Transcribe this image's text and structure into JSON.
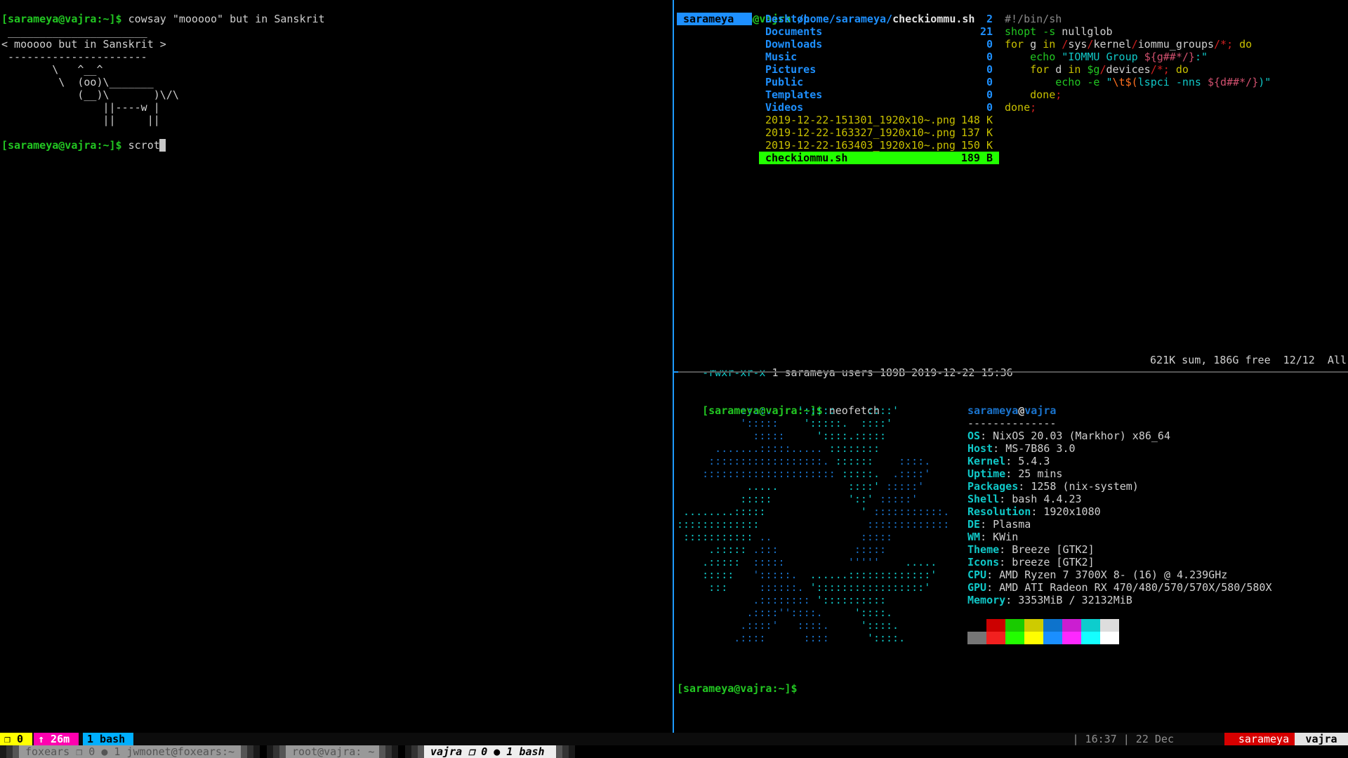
{
  "colors": {
    "fg": "#d0d0d0",
    "green": "#22c722",
    "yellow": "#c8c000",
    "red": "#d02020",
    "cyan": "#10c8c8",
    "blue": "#1a73cc",
    "lightblue": "#1e90ff",
    "pink": "#d0506e",
    "orange": "#ff7020",
    "comment": "#8a8a8a",
    "gray": "#a0a0a0"
  },
  "left": {
    "lines": [
      [
        {
          "t": "[sarameya@vajra:~]$ ",
          "c": "green",
          "b": 1
        },
        {
          "t": "cowsay \"mooooo\" but in Sanskrit",
          "c": "fg"
        }
      ],
      [
        {
          "t": " ______________________",
          "c": "fg"
        }
      ],
      [
        {
          "t": "< mooooo but in Sanskrit >",
          "c": "fg"
        }
      ],
      [
        {
          "t": " ----------------------",
          "c": "fg"
        }
      ],
      [
        {
          "t": "        \\   ^__^",
          "c": "fg"
        }
      ],
      [
        {
          "t": "         \\  (oo)\\_______",
          "c": "fg"
        }
      ],
      [
        {
          "t": "            (__)\\       )\\/\\",
          "c": "fg"
        }
      ],
      [
        {
          "t": "                ||----w |",
          "c": "fg"
        }
      ],
      [
        {
          "t": "                ||     ||",
          "c": "fg"
        }
      ],
      [],
      [
        {
          "t": "[sarameya@vajra:~]$ ",
          "c": "green",
          "b": 1
        },
        {
          "t": "scrot",
          "c": "fg"
        }
      ]
    ]
  },
  "ranger": {
    "title": {
      "user_host": "sarameya@vajra",
      "path": "/home/sarameya/",
      "file": "checkiommu.sh"
    },
    "parent_selected": "sarameya",
    "entries": [
      {
        "name": "Desktop",
        "size": "2",
        "type": "dir"
      },
      {
        "name": "Documents",
        "size": "21",
        "type": "dir"
      },
      {
        "name": "Downloads",
        "size": "0",
        "type": "dir"
      },
      {
        "name": "Music",
        "size": "0",
        "type": "dir"
      },
      {
        "name": "Pictures",
        "size": "0",
        "type": "dir"
      },
      {
        "name": "Public",
        "size": "0",
        "type": "dir"
      },
      {
        "name": "Templates",
        "size": "0",
        "type": "dir"
      },
      {
        "name": "Videos",
        "size": "0",
        "type": "dir"
      },
      {
        "name": "2019-12-22-151301_1920x10~.png",
        "size": "148 K",
        "type": "file"
      },
      {
        "name": "2019-12-22-163327_1920x10~.png",
        "size": "137 K",
        "type": "file"
      },
      {
        "name": "2019-12-22-163403_1920x10~.png",
        "size": "150 K",
        "type": "file"
      },
      {
        "name": "checkiommu.sh",
        "size": "189 B",
        "type": "sel"
      }
    ],
    "preview": [
      [
        {
          "t": "#!/bin/sh",
          "c": "comment"
        }
      ],
      [
        {
          "t": "shopt",
          "c": "green"
        },
        {
          "t": " ",
          "c": "fg"
        },
        {
          "t": "-s",
          "c": "green"
        },
        {
          "t": " nullglob",
          "c": "fg"
        }
      ],
      [
        {
          "t": "for",
          "c": "yellow"
        },
        {
          "t": " g ",
          "c": "fg"
        },
        {
          "t": "in",
          "c": "yellow"
        },
        {
          "t": " ",
          "c": "fg"
        },
        {
          "t": "/",
          "c": "red"
        },
        {
          "t": "sys",
          "c": "fg"
        },
        {
          "t": "/",
          "c": "red"
        },
        {
          "t": "kernel",
          "c": "fg"
        },
        {
          "t": "/",
          "c": "red"
        },
        {
          "t": "iommu_groups",
          "c": "fg"
        },
        {
          "t": "/*;",
          "c": "red"
        },
        {
          "t": " ",
          "c": "fg"
        },
        {
          "t": "do",
          "c": "yellow"
        }
      ],
      [
        {
          "t": "    ",
          "c": "fg"
        },
        {
          "t": "echo",
          "c": "green"
        },
        {
          "t": " ",
          "c": "fg"
        },
        {
          "t": "\"IOMMU Group ",
          "c": "cyan"
        },
        {
          "t": "${g##*/}",
          "c": "pink"
        },
        {
          "t": ":\"",
          "c": "cyan"
        }
      ],
      [
        {
          "t": "    ",
          "c": "fg"
        },
        {
          "t": "for",
          "c": "yellow"
        },
        {
          "t": " d ",
          "c": "fg"
        },
        {
          "t": "in",
          "c": "yellow"
        },
        {
          "t": " ",
          "c": "fg"
        },
        {
          "t": "$g",
          "c": "green"
        },
        {
          "t": "/",
          "c": "red"
        },
        {
          "t": "devices",
          "c": "fg"
        },
        {
          "t": "/*;",
          "c": "red"
        },
        {
          "t": " ",
          "c": "fg"
        },
        {
          "t": "do",
          "c": "yellow"
        }
      ],
      [
        {
          "t": "        ",
          "c": "fg"
        },
        {
          "t": "echo",
          "c": "green"
        },
        {
          "t": " ",
          "c": "fg"
        },
        {
          "t": "-e",
          "c": "green"
        },
        {
          "t": " ",
          "c": "fg"
        },
        {
          "t": "\"",
          "c": "cyan"
        },
        {
          "t": "\\t",
          "c": "orange"
        },
        {
          "t": "$(",
          "c": "orange"
        },
        {
          "t": "lspci -nns ",
          "c": "cyan"
        },
        {
          "t": "${d##*/}",
          "c": "pink"
        },
        {
          "t": ")\"",
          "c": "cyan"
        }
      ],
      [
        {
          "t": "    ",
          "c": "fg"
        },
        {
          "t": "done",
          "c": "yellow"
        },
        {
          "t": ";",
          "c": "red"
        }
      ],
      [
        {
          "t": "done",
          "c": "yellow"
        },
        {
          "t": ";",
          "c": "red"
        }
      ]
    ],
    "status": {
      "perms": "-rwxr-xr-x",
      "info": " 1 sarameya users 189B 2019-12-22 15:36",
      "right": "621K sum, 186G free  12/12  All"
    }
  },
  "neofetch": {
    "prompt": "[sarameya@vajra:~]$ ",
    "command": "neofetch",
    "logo": [
      [
        {
          "t": "          ::::.    ",
          "c": "blue"
        },
        {
          "t": "':::::     ::::'",
          "c": "cyan"
        }
      ],
      [
        {
          "t": "          ':::::    ",
          "c": "blue"
        },
        {
          "t": "':::::.  ::::'",
          "c": "cyan"
        }
      ],
      [
        {
          "t": "            :::::     ",
          "c": "blue"
        },
        {
          "t": "'::::.:::::",
          "c": "cyan"
        }
      ],
      [
        {
          "t": "      .......:::::..... ",
          "c": "blue"
        },
        {
          "t": "::::::::",
          "c": "cyan"
        }
      ],
      [
        {
          "t": "     ::::::::::::::::::. ",
          "c": "blue"
        },
        {
          "t": "::::::    ",
          "c": "cyan"
        },
        {
          "t": "::::.",
          "c": "blue"
        }
      ],
      [
        {
          "t": "    ::::::::::::::::::::: ",
          "c": "blue"
        },
        {
          "t": ":::::.  ",
          "c": "cyan"
        },
        {
          "t": ".::::'",
          "c": "blue"
        }
      ],
      [
        {
          "t": "           .....           ::::' ",
          "c": "cyan"
        },
        {
          "t": ":::::'",
          "c": "blue"
        }
      ],
      [
        {
          "t": "          :::::            '::' ",
          "c": "cyan"
        },
        {
          "t": ":::::'",
          "c": "blue"
        }
      ],
      [
        {
          "t": " ........:::::               ' ",
          "c": "cyan"
        },
        {
          "t": ":::::::::::.",
          "c": "blue"
        }
      ],
      [
        {
          "t": ":::::::::::::                 ",
          "c": "cyan"
        },
        {
          "t": ":::::::::::::",
          "c": "blue"
        }
      ],
      [
        {
          "t": " ::::::::::: ",
          "c": "cyan"
        },
        {
          "t": "..              :::::",
          "c": "blue"
        }
      ],
      [
        {
          "t": "     .::::: ",
          "c": "cyan"
        },
        {
          "t": ".:::            :::::",
          "c": "blue"
        }
      ],
      [
        {
          "t": "    .:::::  ",
          "c": "cyan"
        },
        {
          "t": ":::::          '''''    ",
          "c": "blue"
        },
        {
          "t": ".....",
          "c": "cyan"
        }
      ],
      [
        {
          "t": "    :::::   ",
          "c": "cyan"
        },
        {
          "t": "':::::.  ",
          "c": "blue"
        },
        {
          "t": "......:::::::::::::'",
          "c": "cyan"
        }
      ],
      [
        {
          "t": "     :::     ",
          "c": "cyan"
        },
        {
          "t": "::::::. ",
          "c": "blue"
        },
        {
          "t": "':::::::::::::::::'",
          "c": "cyan"
        }
      ],
      [
        {
          "t": "            .:::::::: ",
          "c": "blue"
        },
        {
          "t": "'::::::::::",
          "c": "cyan"
        }
      ],
      [
        {
          "t": "           .::::''::::.     ",
          "c": "blue"
        },
        {
          "t": "'::::.",
          "c": "cyan"
        }
      ],
      [
        {
          "t": "          .::::'   ::::.     ",
          "c": "blue"
        },
        {
          "t": "'::::.",
          "c": "cyan"
        }
      ],
      [
        {
          "t": "         .::::      ::::      ",
          "c": "blue"
        },
        {
          "t": "'::::.",
          "c": "cyan"
        }
      ]
    ],
    "user": "sarameya",
    "at": "@",
    "host": "vajra",
    "separator": "--------------",
    "fields": [
      {
        "k": "OS",
        "v": "NixOS 20.03 (Markhor) x86_64"
      },
      {
        "k": "Host",
        "v": "MS-7B86 3.0"
      },
      {
        "k": "Kernel",
        "v": "5.4.3"
      },
      {
        "k": "Uptime",
        "v": "25 mins"
      },
      {
        "k": "Packages",
        "v": "1258 (nix-system)"
      },
      {
        "k": "Shell",
        "v": "bash 4.4.23"
      },
      {
        "k": "Resolution",
        "v": "1920x1080"
      },
      {
        "k": "DE",
        "v": "Plasma"
      },
      {
        "k": "WM",
        "v": "KWin"
      },
      {
        "k": "Theme",
        "v": "Breeze [GTK2]"
      },
      {
        "k": "Icons",
        "v": "breeze [GTK2]"
      },
      {
        "k": "CPU",
        "v": "AMD Ryzen 7 3700X 8- (16) @ 4.239GHz"
      },
      {
        "k": "GPU",
        "v": "AMD ATI Radeon RX 470/480/570/570X/580/580X"
      },
      {
        "k": "Memory",
        "v": "3353MiB / 32132MiB"
      }
    ],
    "palette_normal": [
      "#000000",
      "#cc0000",
      "#19cb00",
      "#cecb00",
      "#0d73cc",
      "#cb1ed1",
      "#0dcdcd",
      "#dddddd"
    ],
    "palette_bright": [
      "#767676",
      "#f2201f",
      "#23fd00",
      "#fffd00",
      "#1a8fff",
      "#fd28ff",
      "#14ffff",
      "#ffffff"
    ],
    "final_prompt": "[sarameya@vajra:~]$"
  },
  "tmux": {
    "left": [
      {
        "label": "❐ 0",
        "bg": "#ffff00",
        "fg": "#000000"
      },
      {
        "label": "↑ 26m",
        "bg": "#ff00af",
        "fg": "#ffffff"
      },
      {
        "label": "1 bash",
        "bg": "#00afff",
        "fg": "#000000"
      }
    ],
    "clock": "| 16:37 | 22 Dec",
    "user": "sarameya",
    "host": "vajra"
  },
  "taskbar": {
    "windows": [
      {
        "label": "foxears ❐ 0 ● 1 jwmonet@foxears:~",
        "active": false
      },
      {
        "label": "root@vajra: ~",
        "active": false
      },
      {
        "label": "vajra ❐ 0 ● 1 bash",
        "active": true
      }
    ]
  }
}
